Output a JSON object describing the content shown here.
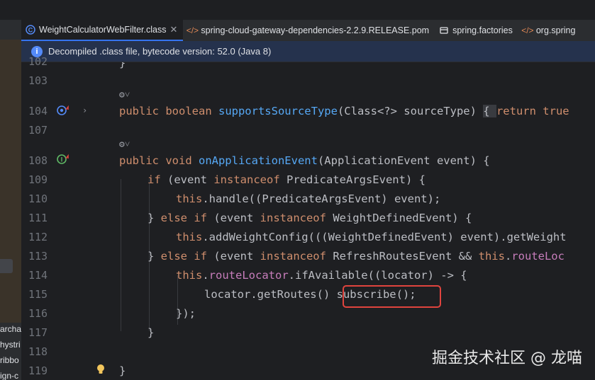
{
  "sidebar": {
    "items": [
      "archa",
      "hystri",
      "ribbo",
      "ign-c"
    ]
  },
  "tabs": [
    {
      "label": "WeightCalculatorWebFilter.class",
      "icon": "class-file-icon",
      "active": true,
      "closable": true
    },
    {
      "label": "spring-cloud-gateway-dependencies-2.2.9.RELEASE.pom",
      "icon": "xml-file-icon",
      "active": false,
      "closable": false
    },
    {
      "label": "spring.factories",
      "icon": "spring-factories-icon",
      "active": false,
      "closable": false
    },
    {
      "label": "org.spring",
      "icon": "xml-file-icon",
      "active": false,
      "closable": false
    }
  ],
  "banner": {
    "icon": "info-icon",
    "text": "Decompiled .class file, bytecode version: 52.0 (Java 8)"
  },
  "editor": {
    "line_numbers": [
      "102",
      "103",
      "104",
      "107",
      "108",
      "109",
      "110",
      "111",
      "112",
      "113",
      "114",
      "115",
      "116",
      "117",
      "118",
      "119"
    ],
    "lines": [
      {
        "n": "102",
        "text": "}"
      },
      {
        "n": "104",
        "t1": "public boolean ",
        "t2": "supportsSourceType",
        "t3": "(Class<?> sourceType) ",
        "t4": "{ ",
        "t5": "return true"
      },
      {
        "n": "108",
        "t1": "public void ",
        "t2": "onApplicationEvent",
        "t3": "(ApplicationEvent event) {"
      },
      {
        "n": "109",
        "t1": "if ",
        "t2": "(event ",
        "t3": "instanceof ",
        "t4": "PredicateArgsEvent) {"
      },
      {
        "n": "110",
        "t1": "this",
        "t2": ".handle((PredicateArgsEvent) event);"
      },
      {
        "n": "111",
        "t1": "} ",
        "t2": "else if ",
        "t3": "(event ",
        "t4": "instanceof ",
        "t5": "WeightDefinedEvent) {"
      },
      {
        "n": "112",
        "t1": "this",
        "t2": ".addWeightConfig(((WeightDefinedEvent) event).getWeight"
      },
      {
        "n": "113",
        "t1": "} ",
        "t2": "else if ",
        "t3": "(event ",
        "t4": "instanceof ",
        "t5": "RefreshRoutesEvent && ",
        "t6": "this",
        "t7": ".",
        "t8": "routeLoc"
      },
      {
        "n": "114",
        "t1": "this",
        "t2": ".",
        "t3": "routeLocator",
        "t4": ".ifAvailable((locator) -> {"
      },
      {
        "n": "115",
        "t1": "locator.getRoutes() ",
        "t2": "subscribe();"
      },
      {
        "n": "116",
        "text": "});"
      },
      {
        "n": "117",
        "text": "}"
      },
      {
        "n": "119",
        "text": "}"
      }
    ]
  },
  "gutter_icons": {
    "line104": "overrides-method-icon",
    "line108": "implements-method-icon",
    "line119": "lightbulb-icon",
    "annotations": "users-annotation-icon"
  },
  "watermark": "掘金技术社区 @ 龙喵",
  "colors": {
    "background": "#1e1f22",
    "keyword": "#cf8e6d",
    "method": "#56a8f5",
    "field": "#c77dbb",
    "text": "#bcbec4",
    "line_number": "#6f737a",
    "highlight_box": "#e0443e",
    "banner_bg": "#25324d",
    "accent": "#3574f0"
  }
}
